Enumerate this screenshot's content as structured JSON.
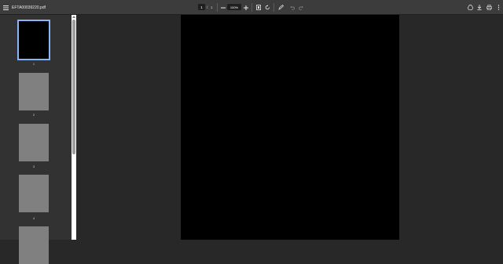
{
  "window": {
    "title": "EFTA00039220.pdf"
  },
  "toolbar": {
    "current_page": "1",
    "page_separator": "/",
    "total_pages": "1",
    "zoom": "100%"
  },
  "sidebar": {
    "thumbnails": [
      {
        "label": "1",
        "selected": true
      },
      {
        "label": "2",
        "selected": false
      },
      {
        "label": "3",
        "selected": false
      },
      {
        "label": "4",
        "selected": false
      }
    ]
  },
  "icons": {
    "menu": "menu-icon",
    "zoom_out": "minus-icon",
    "zoom_in": "plus-icon",
    "fit": "fit-page-icon",
    "rotate": "rotate-icon",
    "annotate": "annotate-icon",
    "undo": "undo-icon",
    "redo": "redo-icon",
    "drive": "drive-icon",
    "download": "download-icon",
    "print": "print-icon",
    "more": "more-vertical-icon"
  },
  "colors": {
    "selected_outline": "#8ab4f8",
    "toolbar": "#3c3c3c",
    "background": "#282828"
  }
}
